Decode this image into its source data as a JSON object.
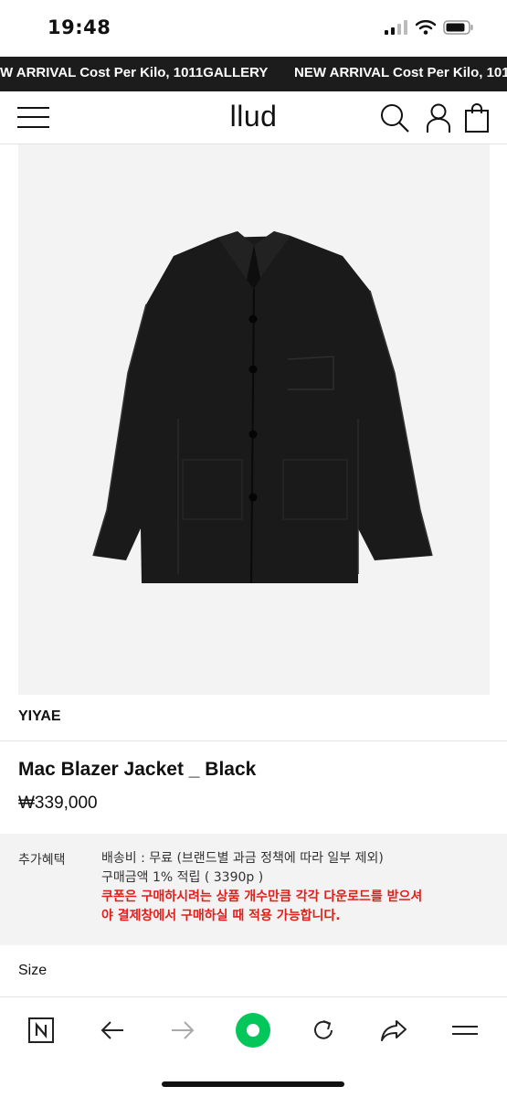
{
  "status": {
    "time": "19:48"
  },
  "marquee": {
    "text_1": "W ARRIVAL Cost Per Kilo, 1011GALLERY",
    "text_2": "NEW ARRIVAL Cost Per Kilo, 1011GALLERY"
  },
  "header": {
    "logo": "llud"
  },
  "icons": {
    "menu": "hamburger-icon",
    "search": "search-icon",
    "account": "user-icon",
    "cart": "shopping-bag-icon"
  },
  "product": {
    "brand": "YIYAE",
    "name": "Mac Blazer Jacket _ Black",
    "price": "₩339,000",
    "image": "black-jacket-photo"
  },
  "benefit": {
    "label": "추가혜택",
    "shipping": "배송비 : 무료 (브랜드별 과금 정책에 따라 일부 제외)",
    "points": "구매금액 1% 적립 ( 3390p )",
    "coupon_line1": "쿠폰은 구매하시려는 상품 개수만큼 각각 다운로드를 받으셔",
    "coupon_line2": "야 결제창에서 구매하실 때 적용 가능합니다."
  },
  "options": {
    "size_label": "Size"
  },
  "toolbar": {
    "items": [
      "naver-icon",
      "back-arrow-icon",
      "forward-arrow-icon",
      "green-home-icon",
      "refresh-icon",
      "share-icon",
      "menu-lines-icon"
    ]
  },
  "colors": {
    "marquee_bg": "#1c1c1c",
    "warning_red": "#e0201b",
    "naver_green": "#03c75a",
    "benefit_bg": "#f3f3f3"
  }
}
